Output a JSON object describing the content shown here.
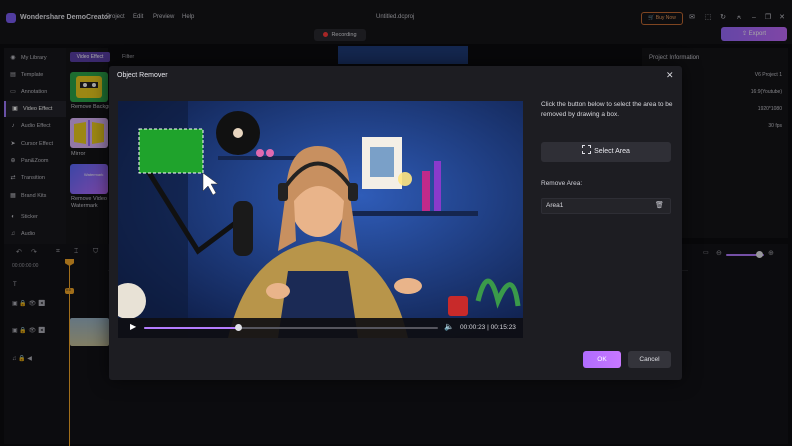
{
  "app": {
    "name": "Wondershare DemoCreator",
    "menu": [
      "Project",
      "Edit",
      "Preview",
      "Help"
    ],
    "filename": "Untitled.dcproj",
    "buy_now": "Buy Now",
    "recording": "Recording",
    "export": "Export"
  },
  "sidebar": {
    "items": [
      {
        "label": "My Library",
        "icon": "library-icon"
      },
      {
        "label": "Template",
        "icon": "template-icon"
      },
      {
        "label": "Annotation",
        "icon": "annotation-icon"
      },
      {
        "label": "Video Effect",
        "icon": "video-effect-icon"
      },
      {
        "label": "Audio Effect",
        "icon": "audio-effect-icon"
      },
      {
        "label": "Cursor Effect",
        "icon": "cursor-icon"
      },
      {
        "label": "Pan&Zoom",
        "icon": "pan-zoom-icon"
      },
      {
        "label": "Transition",
        "icon": "transition-icon"
      },
      {
        "label": "Brand Kits",
        "icon": "brand-kit-icon"
      },
      {
        "label": "Sticker",
        "icon": "sticker-icon"
      },
      {
        "label": "Audio",
        "icon": "audio-icon"
      }
    ],
    "active": "Video Effect"
  },
  "library": {
    "tabs": [
      "Video Effect",
      "Filter"
    ],
    "items": [
      {
        "label": "Remove Backgro"
      },
      {
        "label": "Mirror"
      },
      {
        "label": "Remove Video",
        "label2": "Watermark"
      }
    ],
    "watermark_thumb_text": "Watermark"
  },
  "project": {
    "title": "Project Information",
    "values": [
      "V6 Project 1",
      "16:9(Youtube)",
      "1920*1080",
      "30 fps"
    ]
  },
  "timeline": {
    "timecode": "00:00:00:00",
    "playhead_label": "0:0"
  },
  "modal": {
    "title": "Object Remover",
    "instruction": "Click the button below to select the area to be removed by drawing a box.",
    "select_area": "Select Area",
    "remove_area_label": "Remove Area:",
    "area_item": "Area1",
    "ok": "OK",
    "cancel": "Cancel",
    "time_current": "00:00:23",
    "time_total": "00:15:23",
    "progress": 0.32
  },
  "colors": {
    "accent": "#b06cff",
    "playhead": "#f7a928",
    "selection_fill": "#1fa32c"
  }
}
